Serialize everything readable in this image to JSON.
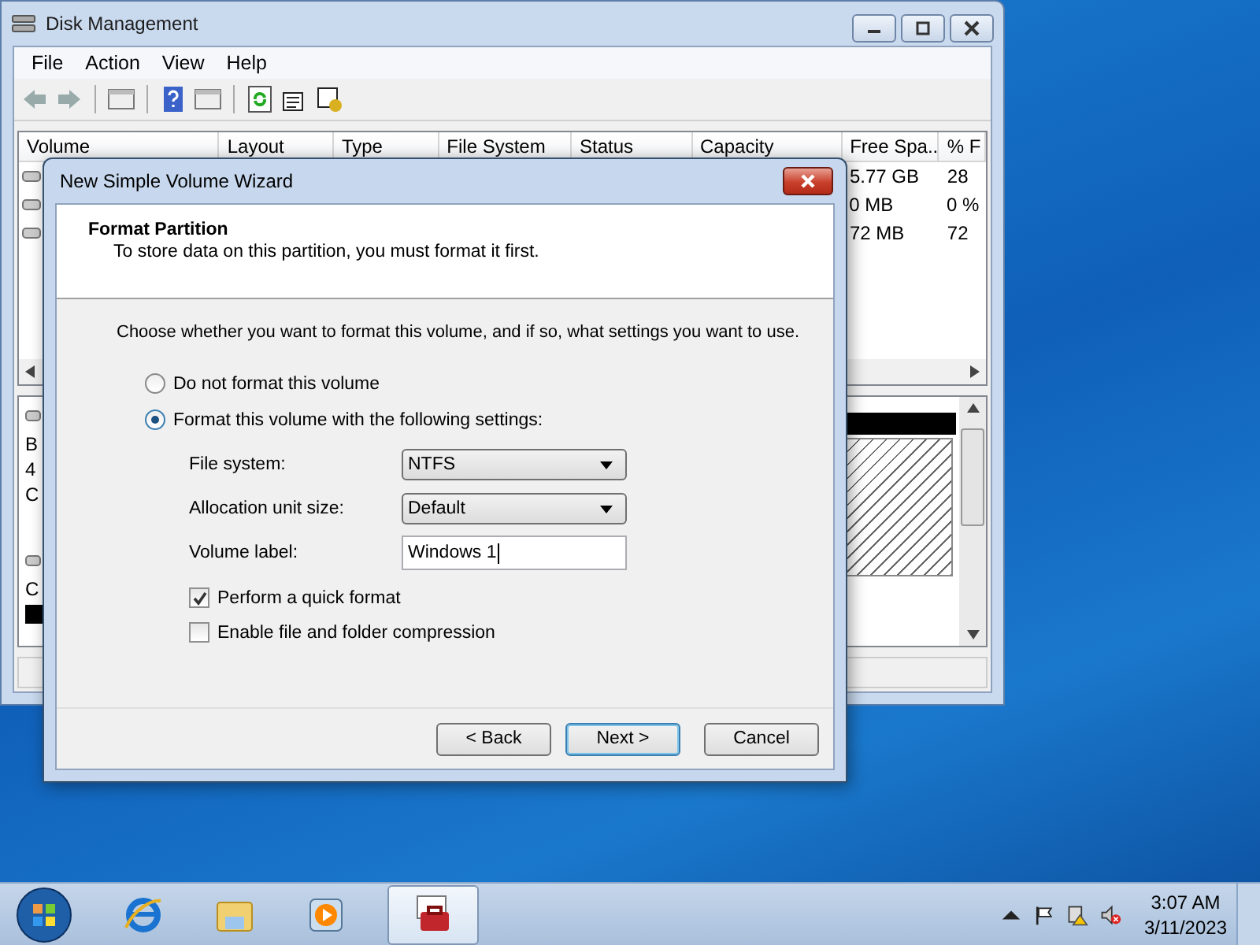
{
  "main_window": {
    "title": "Disk Management",
    "menu": [
      "File",
      "Action",
      "View",
      "Help"
    ],
    "columns": [
      "Volume",
      "Layout",
      "Type",
      "File System",
      "Status",
      "Capacity",
      "Free Spa...",
      "% F"
    ],
    "rows": [
      {
        "free_space": "5.77 GB",
        "percent_free": "28"
      },
      {
        "free_space": "0 MB",
        "percent_free": "0 %"
      },
      {
        "free_space": "72 MB",
        "percent_free": "72"
      }
    ],
    "disk_fragments": [
      "B",
      "4",
      "C"
    ],
    "lower_fragment": "C"
  },
  "dialog": {
    "title": "New Simple Volume Wizard",
    "heading": "Format Partition",
    "subheading": "To store data on this partition, you must format it first.",
    "instruction": "Choose whether you want to format this volume, and if so, what settings you want to use.",
    "options": [
      {
        "label": "Do not format this volume",
        "selected": false
      },
      {
        "label": "Format this volume with the following settings:",
        "selected": true
      }
    ],
    "settings": [
      {
        "kind": "dropdown",
        "label": "File system:",
        "value": "NTFS"
      },
      {
        "kind": "dropdown",
        "label": "Allocation unit size:",
        "value": "Default"
      },
      {
        "kind": "text",
        "label": "Volume label:",
        "value": "Windows 1"
      }
    ],
    "checkboxes": [
      {
        "label": "Perform a quick format",
        "checked": true
      },
      {
        "label": "Enable file and folder compression",
        "checked": false
      }
    ],
    "buttons": [
      {
        "label": "< Back",
        "default": false
      },
      {
        "label": "Next >",
        "default": true
      },
      {
        "label": "Cancel",
        "default": false
      }
    ]
  },
  "taskbar": {
    "apps": [
      {
        "kind": "browser",
        "active": false
      },
      {
        "kind": "folder",
        "active": false
      },
      {
        "kind": "media",
        "active": false
      },
      {
        "kind": "toolbox",
        "active": true
      }
    ],
    "time": "3:07 AM",
    "date": "3/11/2023"
  }
}
